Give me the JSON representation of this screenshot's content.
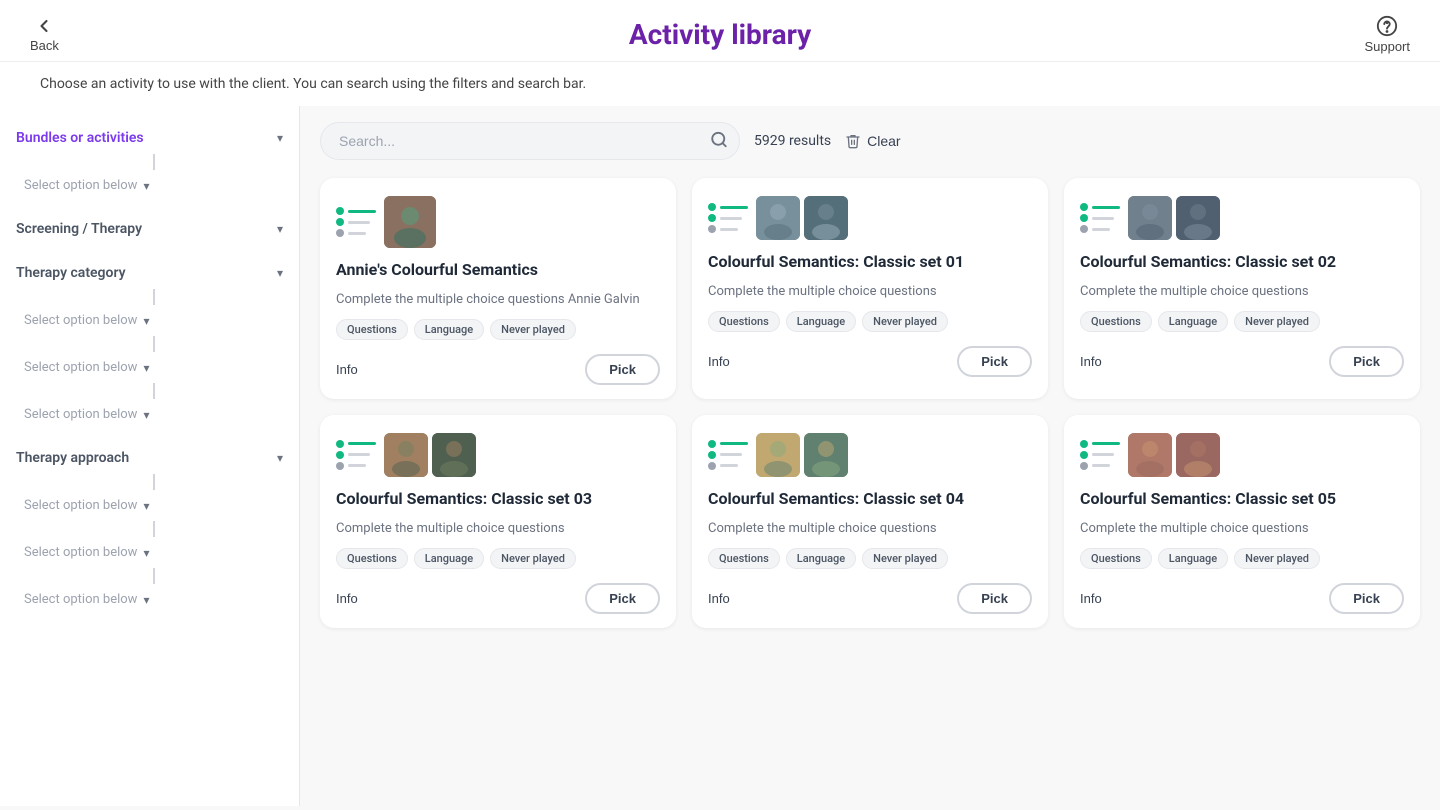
{
  "header": {
    "back_label": "Back",
    "title": "Activity library",
    "support_label": "Support"
  },
  "subtitle": "Choose an activity to use with the client. You can search using the filters and search bar.",
  "search": {
    "placeholder": "Search...",
    "results_count": "5929 results",
    "clear_label": "Clear"
  },
  "sidebar": {
    "sections": [
      {
        "id": "bundles-or-activities",
        "label": "Bundles or activities",
        "active": true,
        "options": [
          {
            "label": "Select option below"
          }
        ]
      },
      {
        "id": "screening-therapy",
        "label": "Screening / Therapy",
        "active": false,
        "options": []
      },
      {
        "id": "therapy-category",
        "label": "Therapy category",
        "active": false,
        "options": [
          {
            "label": "Select option below"
          },
          {
            "label": "Select option below"
          },
          {
            "label": "Select option below"
          }
        ]
      },
      {
        "id": "therapy-approach",
        "label": "Therapy approach",
        "active": false,
        "options": [
          {
            "label": "Select option below"
          },
          {
            "label": "Select option below"
          },
          {
            "label": "Select option below"
          }
        ]
      }
    ]
  },
  "cards": [
    {
      "id": 1,
      "title": "Annie's Colourful Semantics",
      "description": "Complete the multiple choice questions Annie Galvin",
      "tags": [
        "Questions",
        "Language",
        "Never played"
      ],
      "has_single_thumb": true,
      "thumb_color": "#a3b18a"
    },
    {
      "id": 2,
      "title": "Colourful Semantics: Classic set 01",
      "description": "Complete the multiple choice questions",
      "tags": [
        "Questions",
        "Language",
        "Never played"
      ],
      "has_single_thumb": false,
      "thumb_colors": [
        "#78909c",
        "#b0bec5",
        "#546e7a"
      ]
    },
    {
      "id": 3,
      "title": "Colourful Semantics: Classic set 02",
      "description": "Complete the multiple choice questions",
      "tags": [
        "Questions",
        "Language",
        "Never played"
      ],
      "has_single_thumb": false,
      "thumb_colors": [
        "#78909c",
        "#90a4ae",
        "#546e7a"
      ]
    },
    {
      "id": 4,
      "title": "Colourful Semantics: Classic set 03",
      "description": "Complete the multiple choice questions",
      "tags": [
        "Questions",
        "Language",
        "Never played"
      ],
      "has_single_thumb": false,
      "thumb_colors": [
        "#a0856c",
        "#8d9b8a",
        "#6b7c6e"
      ]
    },
    {
      "id": 5,
      "title": "Colourful Semantics: Classic set 04",
      "description": "Complete the multiple choice questions",
      "tags": [
        "Questions",
        "Language",
        "Never played"
      ],
      "has_single_thumb": false,
      "thumb_colors": [
        "#c8b88a",
        "#9eb89a",
        "#7a9880"
      ]
    },
    {
      "id": 6,
      "title": "Colourful Semantics: Classic set 05",
      "description": "Complete the multiple choice questions",
      "tags": [
        "Questions",
        "Language",
        "Never played"
      ],
      "has_single_thumb": false,
      "thumb_colors": [
        "#b08a7c",
        "#d4a47c",
        "#9a7a70"
      ]
    }
  ],
  "labels": {
    "info": "Info",
    "pick": "Pick"
  }
}
